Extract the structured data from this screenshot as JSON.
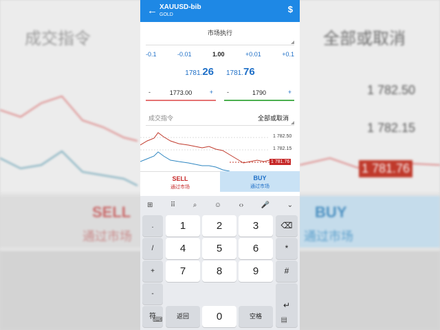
{
  "background": {
    "left_title": "成交指令",
    "right_title": "全部或取消",
    "prices": [
      "1 782.50",
      "1 782.15",
      "1 781.76"
    ],
    "sell_label": "SELL",
    "sell_sub": "通过市场",
    "buy_label": "BUY",
    "buy_sub": "通过市场"
  },
  "header": {
    "back_icon": "←",
    "symbol": "XAUUSD-bib",
    "subtitle": "GOLD",
    "dollar_icon": "$"
  },
  "order": {
    "type": "市场执行",
    "steps": [
      "-0.1",
      "-0.01",
      "1.00",
      "+0.01",
      "+0.1"
    ],
    "sell_price_main": "1781.",
    "sell_price_big": "26",
    "buy_price_main": "1781.",
    "buy_price_big": "76",
    "sl": {
      "minus": "-",
      "value": "1773.00",
      "plus": "+"
    },
    "tp": {
      "minus": "-",
      "value": "1790",
      "plus": "+"
    },
    "fill_label": "成交指令",
    "fill_value": "全部或取消"
  },
  "chart": {
    "price_labels": [
      "1 782.50",
      "1 782.15",
      "1 781.76"
    ]
  },
  "tradebar": {
    "sell": "SELL",
    "sell_sub": "通过市场",
    "buy": "BUY",
    "buy_sub": "通过市场"
  },
  "keyboard": {
    "toolbar": [
      "⊞",
      "⠿",
      "⌕",
      "☺",
      "‹›",
      "🎤",
      "⌄"
    ],
    "side_keys": [
      ".",
      "/",
      "+",
      "-",
      "符"
    ],
    "digits": [
      "1",
      "2",
      "3",
      "4",
      "5",
      "6",
      "7",
      "8",
      "9"
    ],
    "right_keys": [
      "⌫",
      "*",
      "#",
      "↵"
    ],
    "back_key": "返回",
    "zero": "0",
    "space_key": "空格",
    "bottom_left": "⌨",
    "bottom_right": "▤"
  }
}
